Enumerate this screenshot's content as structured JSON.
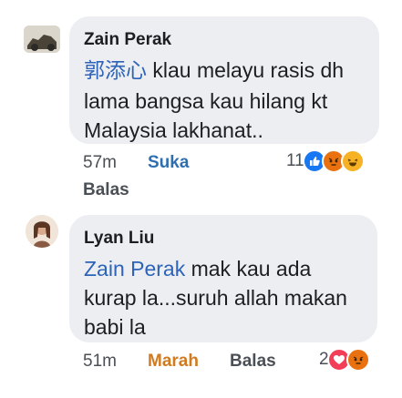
{
  "comments": [
    {
      "author": "Zain Perak",
      "mention": "郭添心",
      "text_line1": " klau melayu rasis dh",
      "text_line2": "lama bangsa kau hilang kt",
      "text_line3": "Malaysia lakhanat..",
      "time": "57m",
      "reaction_label": "Suka",
      "reply_label": "Balas",
      "reaction_count": "11",
      "reactions": [
        "like-icon",
        "angry-icon",
        "haha-icon"
      ],
      "colors": {
        "like": "#1877f2",
        "angry": "#e9710f",
        "haha": "#f7b125"
      }
    },
    {
      "author": "Lyan Liu",
      "mention": "Zain Perak",
      "text_line1": " mak kau ada",
      "text_line2": "kurap la...suruh allah makan",
      "text_line3": "babi la",
      "time": "51m",
      "reaction_label": "Marah",
      "reply_label": "Balas",
      "reaction_count": "2",
      "reactions": [
        "love-icon",
        "angry-icon"
      ],
      "colors": {
        "love": "#f33e58",
        "angry": "#e9710f"
      }
    }
  ]
}
